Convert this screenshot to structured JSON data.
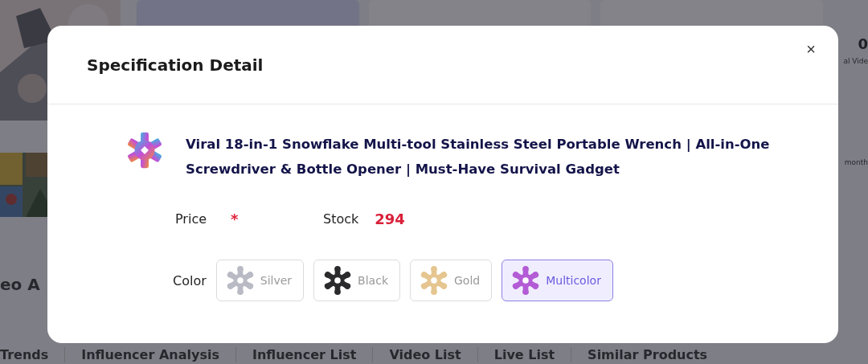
{
  "background": {
    "stat_value": "0",
    "stat_label": "al Vide",
    "period": "month",
    "section_heading": "eo A",
    "tabs": [
      {
        "label": "Trends"
      },
      {
        "label": "Influencer Analysis"
      },
      {
        "label": "Influencer List"
      },
      {
        "label": "Video List"
      },
      {
        "label": "Live List"
      },
      {
        "label": "Similar Products"
      }
    ]
  },
  "dialog": {
    "title": "Specification Detail",
    "close": "×",
    "product": {
      "name": "Viral 18-in-1 Snowflake Multi-tool Stainless Steel Portable Wrench | All-in-One Screwdriver & Bottle Opener | Must-Have Survival Gadget"
    },
    "price": {
      "label": "Price",
      "value": "*"
    },
    "stock": {
      "label": "Stock",
      "value": "294"
    },
    "color": {
      "label": "Color",
      "options": [
        {
          "label": "Silver",
          "selected": false,
          "color": "#b8bac4"
        },
        {
          "label": "Black",
          "selected": false,
          "color": "#2b2b2e"
        },
        {
          "label": "Gold",
          "selected": false,
          "color": "#e6c690"
        },
        {
          "label": "Multicolor",
          "selected": true,
          "color": "#b35cd6"
        }
      ]
    }
  }
}
